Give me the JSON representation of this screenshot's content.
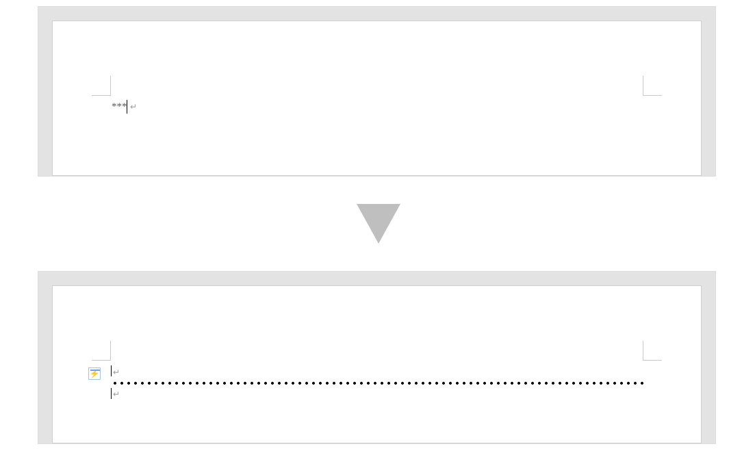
{
  "before": {
    "typed_text": "***",
    "paragraph_mark": "↵"
  },
  "after": {
    "paragraph_mark_1": "↵",
    "paragraph_mark_2": "↵",
    "autocorrect_badge": "autocorrect-options"
  }
}
